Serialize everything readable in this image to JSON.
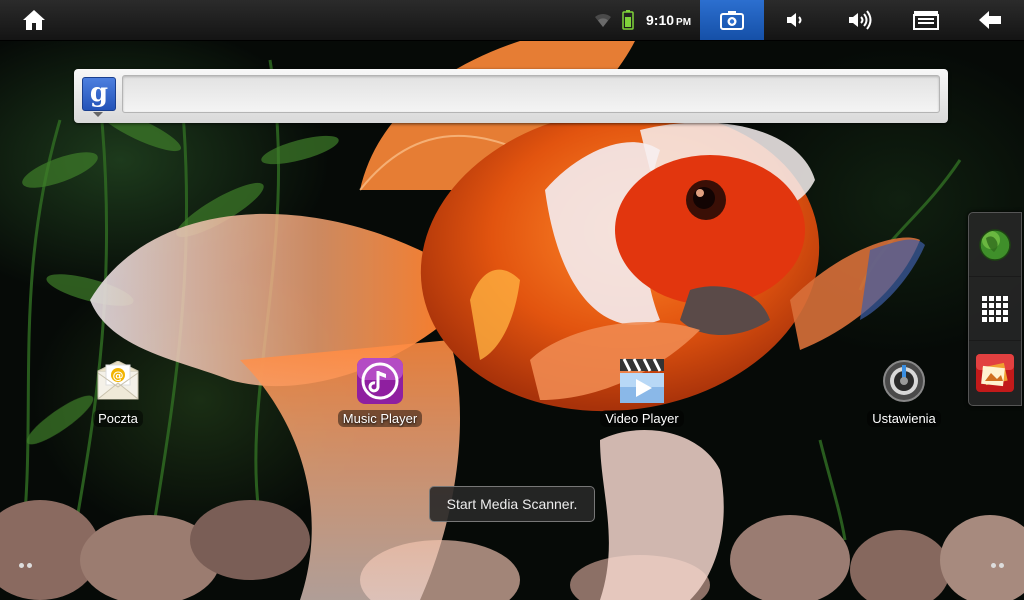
{
  "status_bar": {
    "time": "9:10",
    "ampm": "PM",
    "icons": [
      "home-icon",
      "wifi-icon",
      "battery-icon",
      "camera-icon",
      "volume-down-icon",
      "volume-up-icon",
      "menu-icon",
      "back-icon"
    ]
  },
  "search": {
    "logo_letter": "g",
    "value": ""
  },
  "apps": [
    {
      "label": "Poczta",
      "icon": "mail-icon"
    },
    {
      "label": "Music Player",
      "icon": "music-icon"
    },
    {
      "label": "Video Player",
      "icon": "video-icon"
    },
    {
      "label": "Ustawienia",
      "icon": "settings-icon"
    }
  ],
  "dock": {
    "items": [
      "browser-globe-icon",
      "app-grid-icon",
      "gallery-icon"
    ]
  },
  "toast": {
    "text": "Start Media Scanner."
  },
  "colors": {
    "camera_active": "#2c6fd0",
    "battery": "#7fd33a"
  }
}
